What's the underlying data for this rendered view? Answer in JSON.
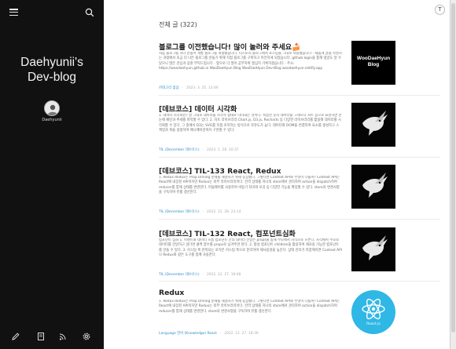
{
  "sidebar": {
    "blog_title_line1": "Daehyunii's",
    "blog_title_line2": "Dev-blog",
    "author": "Daehyunii"
  },
  "list": {
    "label": "전체 글",
    "count": "(322)"
  },
  "posts": [
    {
      "title": "블로그를 이전했습니다! 많이 놀러와 주세요🍰",
      "excerpt": "처음 블로그를 하나 만들어 개발 블로그를 개설했습니다. 티스토리 블로그에서 포스팅을 그대로 사용했습니다 - 새롭게 글을 작성하는 과정에서 조금 더 나은 블로그를 만들기 위해 직접 블로그를 구축하고 이전하게 되었습니다. github login을 통해 댓글도 달 수 있으니 많은 관심과 응원 부탁드립니다 - 앞으로 더 많이 공부하며 열심히 기록하겠습니다 - 주소: https://woodaehyun.github.io WooDaeHyun Blog WooDaeHyun Dev-Blog woodaehyun.netlify.app",
      "category": "카테고리 없음",
      "date": "2023. 3. 25. 13:46",
      "thumb_text_line1": "WooDaeHyun",
      "thumb_text_line2": "Blog"
    },
    {
      "title": "[데브코스] 데이터 시각화",
      "excerpt": "1. 데이터 시각화란? 말 그대로 데이터를 시각적 형태로 나타내는 것이다. 복잡한 숫자 데이터를 그래프나 차트 등으로 표현하면 한 눈에 패턴과 추세를 파악할 수 있다. 2. 차트 라이브러리 Chart.js, D3.js, Recharts 등 다양한 라이브러리를 활용해 데이터를 시각화할 수 있다. 그 중에서 D3는 SVG를 직접 조작하는 방식으로 자유도가 높다. 데이터와 DOM을 연결하여 요소를 생성하고 스케일과 축을 설정하며 애니메이션까지 구현할 수 있다.",
      "category": "TIL (December 데브코스)",
      "date": "2023. 1. 28. 20:37"
    },
    {
      "title": "[데브코스] TIL-133 React, Redux",
      "excerpt": "1. Redux Redux는 Prop Drilling 문제를 해결하기 위해 등장했다. 그렇다면 Context API와 무엇이 다를까? Context API는 React에 내장된 API이지만 Redux는 외부 라이브러리이다. 전역 상태를 하나의 store에서 관리하며 action을 dispatch하여 reducer를 통해 상태를 변경한다. 미들웨어를 사용하여 비동기 처리와 로깅 등 다양한 기능을 확장할 수 있다. store의 변경사항을 구독하여 뷰를 갱신한다.",
      "category": "TIL (December 데브코스)",
      "date": "2022. 12. 28. 23:14"
    },
    {
      "title": "[데브코스] TIL-132 React, 컴포넌트심화",
      "excerpt": "컴포넌트 심화 1. 이벤트와 데이터 흐름 컴포넌트 간의 데이터 전달은 props를 통해 부모에서 자식으로 흐른다. 자식에서 부모로 데이터를 전달하고 싶다면 콜백 함수를 props로 넘겨주면 된다. 2. 합성 컴포넌트 children을 활용하여 재사용 가능한 컴포넌트를 만들 수 있다. 3. 커스텀 훅 반복되는 로직은 커스텀 훅으로 분리하여 재사용성을 높인다. 상태 관리가 복잡해지면 Context API나 Redux와 같은 도구를 함께 사용한다.",
      "category": "TIL (December 데브코스)",
      "date": "2022. 12. 27. 19:08"
    },
    {
      "title": "Redux",
      "excerpt": "1. Redux Redux는 Prop Drilling 문제를 해결하기 위해 등장했다. 그렇다면 Context API와 무엇이 다를까? Context API는 React에 내장된 API이지만 Redux는 외부 라이브러리이다. 전역 상태를 하나의 store에서 관리하며 action을 dispatch하여 reducer를 통해 상태를 변경한다. store의 변경사항을 구독하여 뷰를 갱신한다.",
      "category": "Language 언어 (Knowledge) React",
      "date": "2022. 12. 27. 18:30",
      "thumb_text": "React.js"
    }
  ],
  "colors": {
    "sidebar_bg": "#111111",
    "accent": "#2f8fc8",
    "react_blue": "#2fb7e6"
  }
}
